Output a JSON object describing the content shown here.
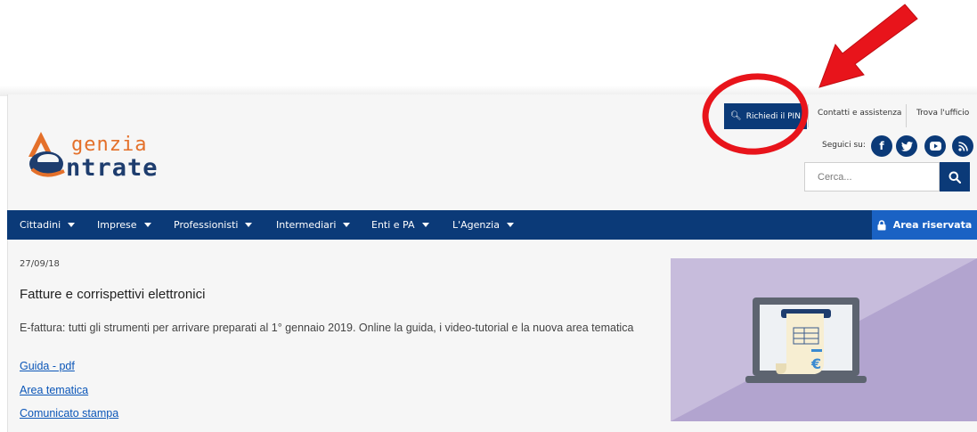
{
  "header": {
    "pin_button_label": "Richiedi il PIN",
    "contacts_link": "Contatti e assistenza",
    "office_link": "Trova l'ufficio",
    "follow_label": "Seguici su:",
    "social_icons": [
      "facebook-icon",
      "twitter-icon",
      "youtube-icon",
      "rss-icon"
    ]
  },
  "logo": {
    "word1": "genzia",
    "word2": "ntrate"
  },
  "search": {
    "placeholder": "Cerca..."
  },
  "nav": {
    "items": [
      {
        "label": "Cittadini"
      },
      {
        "label": "Imprese"
      },
      {
        "label": "Professionisti"
      },
      {
        "label": "Intermediari"
      },
      {
        "label": "Enti e PA"
      },
      {
        "label": "L'Agenzia"
      }
    ],
    "reserved_label": "Area riservata"
  },
  "article": {
    "date": "27/09/18",
    "title": "Fatture e corrispettivi elettronici",
    "body": "E-fattura: tutti gli strumenti per arrivare preparati al 1° gennaio 2019. Online la guida, i video-tutorial e la nuova area tematica",
    "links": [
      "Guida - pdf",
      "Area tematica",
      "Comunicato stampa"
    ]
  },
  "colors": {
    "brand_blue": "#0b3a78",
    "reserved_blue": "#1a62c4",
    "logo_orange": "#e4702a",
    "annotation_red": "#e8141b",
    "illustration_bg": "#c2b6d9"
  }
}
